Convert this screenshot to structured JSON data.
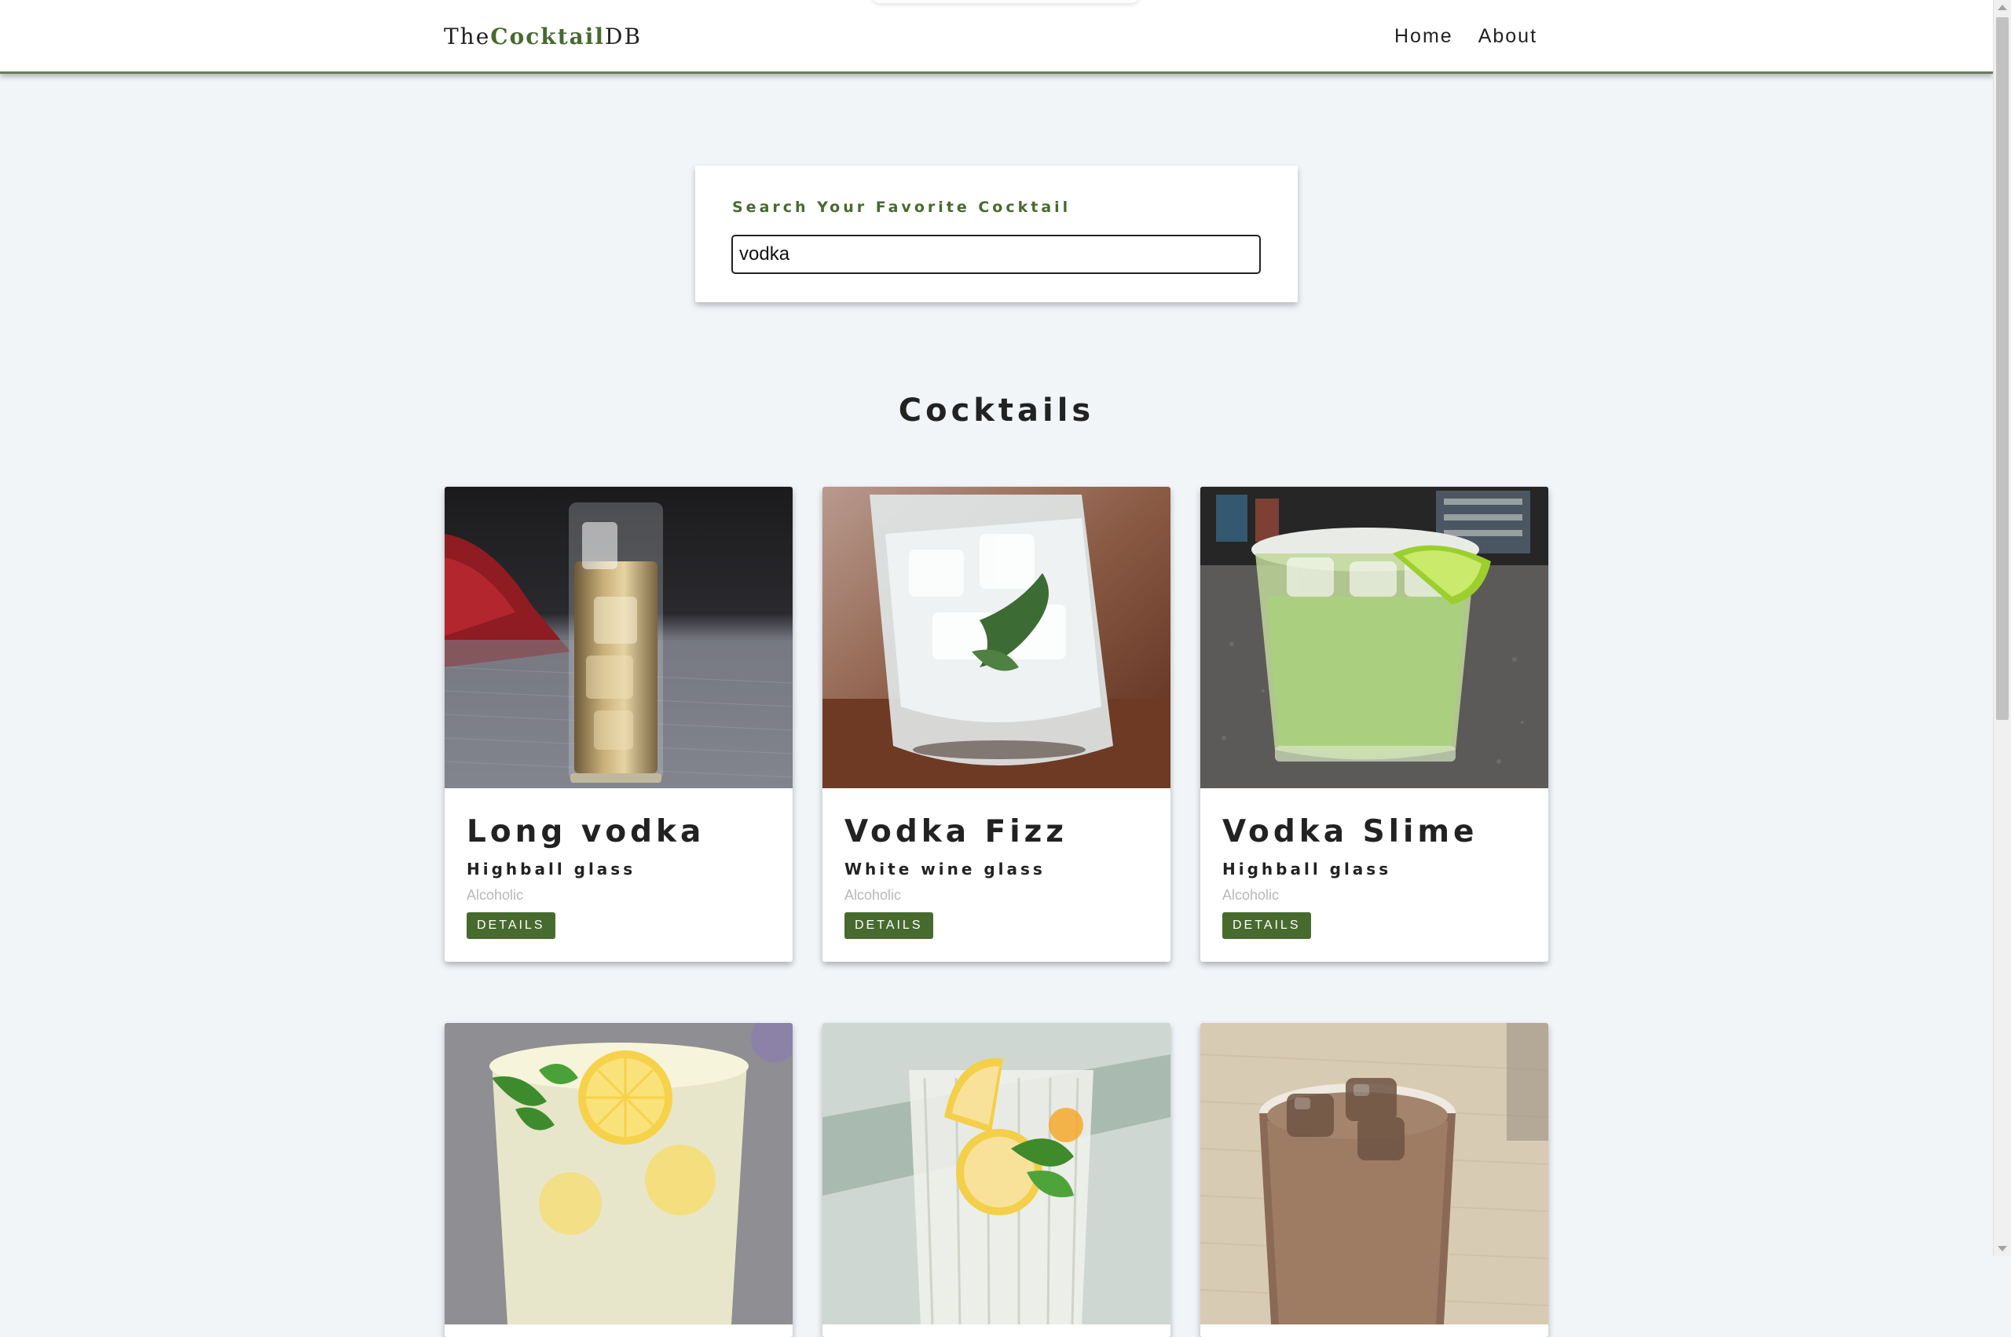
{
  "navbar": {
    "logo_prefix": "The",
    "logo_accent": "Cocktail",
    "logo_suffix": "DB",
    "links": [
      "Home",
      "About"
    ]
  },
  "search": {
    "label": "Search Your Favorite Cocktail",
    "value": "vodka"
  },
  "section_title": "Cocktails",
  "cocktails": [
    {
      "name": "Long vodka",
      "glass": "Highball glass",
      "info": "Alcoholic",
      "button": "DETAILS"
    },
    {
      "name": "Vodka Fizz",
      "glass": "White wine glass",
      "info": "Alcoholic",
      "button": "DETAILS"
    },
    {
      "name": "Vodka Slime",
      "glass": "Highball glass",
      "info": "Alcoholic",
      "button": "DETAILS"
    },
    {
      "name": "",
      "glass": "",
      "info": "",
      "button": ""
    },
    {
      "name": "",
      "glass": "",
      "info": "",
      "button": ""
    },
    {
      "name": "",
      "glass": "",
      "info": "",
      "button": ""
    }
  ],
  "colors": {
    "brand_green": "#476a2e",
    "background": "#f1f5f8"
  }
}
